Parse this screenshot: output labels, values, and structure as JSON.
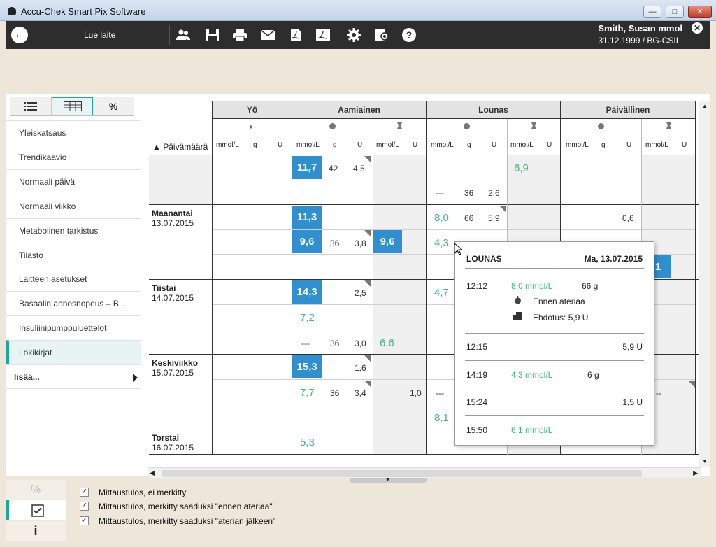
{
  "window": {
    "title": "Accu-Chek Smart Pix Software"
  },
  "toolbar": {
    "device_label": "Lue laite",
    "user_name": "Smith, Susan mmol",
    "user_detail": "31.12.1999 / BG-CSII"
  },
  "views": {
    "percent": "%"
  },
  "nav": {
    "items": [
      "Yleiskatsaus",
      "Trendikaavio",
      "Normaali päivä",
      "Normaali viikko",
      "Metabolinen tarkistus",
      "Tilasto",
      "Laitteen asetukset",
      "Basaalin annosnopeus – B...",
      "Insuliinipumppuluettelot",
      "Lokikirjat"
    ],
    "more": "lisää..."
  },
  "table": {
    "sort_label": "Päivämäärä",
    "groups": [
      "Yö",
      "Aamiainen",
      "Lounas",
      "Päivällinen"
    ],
    "units": {
      "mmol": "mmol/L",
      "g": "g",
      "u": "U"
    },
    "days": [
      {
        "name": "Maanantai",
        "date": "13.07.2015"
      },
      {
        "name": "Tiistai",
        "date": "14.07.2015"
      },
      {
        "name": "Keskiviikko",
        "date": "15.07.2015"
      },
      {
        "name": "Torstai",
        "date": "16.07.2015"
      }
    ],
    "cells": {
      "r1_bf": "11,7",
      "r1_bf_g": "42",
      "r1_bf_u": "4,5",
      "r1_lu_after": "6,9",
      "r2_lu_dash": "---",
      "r2_lu_g": "36",
      "r2_lu_u": "2,6",
      "mo1_bf": "11,3",
      "mo1_lu": "8,0",
      "mo1_lu_g": "66",
      "mo1_lu_u": "5,9",
      "mo1_din_u": "0,6",
      "mo2_bf": "9,6",
      "mo2_bf_g": "36",
      "mo2_bf_u": "3,8",
      "mo2_bf_after": "9,6",
      "mo2_lu": "4,3",
      "tu1_bf": "14,3",
      "tu1_bf_u": "2,5",
      "tu1_lu": "4,7",
      "tu2_bf": "7,2",
      "tu3_dash": "---",
      "tu3_g": "36",
      "tu3_u": "3,0",
      "tu3_after": "6,6",
      "we1_bf": "15,3",
      "we1_bf_u": "1,6",
      "we2_bf": "7,7",
      "we2_bf_g": "36",
      "we2_bf_u": "3,4",
      "we2_bf_after_u": "1,0",
      "we2_lu_dash": "---",
      "we2_din_dash": "--",
      "we3_lu": "8,1",
      "th1_bf": "5,3",
      "din_partial": ",1"
    }
  },
  "popup": {
    "title": "LOUNAS",
    "date": "Ma, 13.07.2015",
    "rows": [
      {
        "time": "12:12",
        "value": "8,0 mmol/L",
        "carb": "66 g",
        "before": "Ennen ateriaa",
        "suggest": "Ehdotus: 5,9 U"
      },
      {
        "time": "12:15",
        "units": "5,9 U"
      },
      {
        "time": "14:19",
        "value": "4,3 mmol/L",
        "carb": "6 g"
      },
      {
        "time": "15:24",
        "units": "1,5 U"
      },
      {
        "time": "15:50",
        "value": "6,1 mmol/L"
      }
    ]
  },
  "legend": {
    "items": [
      "Mittaustulos, ei merkitty",
      "Mittaustulos, merkitty saaduksi \"ennen ateriaa\"",
      "Mittaustulos, merkitty saaduksi \"aterian jälkeen\""
    ],
    "tab_percent": "%",
    "tab_info": "i"
  },
  "colors": {
    "accent": "#1aa99a",
    "blue_cell": "#2f8fcf",
    "green_value": "#3bb97a",
    "toolbar": "#2d2d2d"
  }
}
